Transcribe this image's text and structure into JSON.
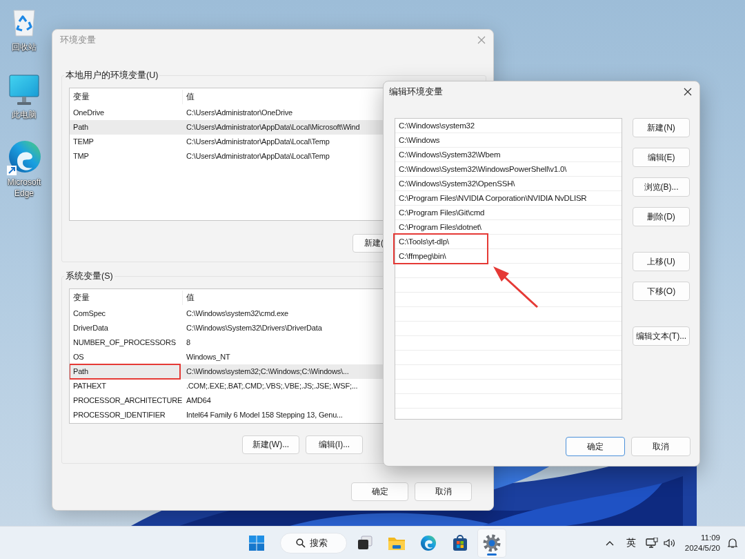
{
  "desktop_icons": [
    {
      "label": "回收站",
      "kind": "recycle-bin"
    },
    {
      "label": "此电脑",
      "kind": "computer"
    },
    {
      "label": "Microsoft Edge",
      "kind": "edge"
    }
  ],
  "env_dialog": {
    "title": "环境变量",
    "active": false,
    "user_group": {
      "label": "本地用户的环境变量(U)",
      "columns": [
        "变量",
        "值"
      ],
      "rows": [
        {
          "name": "OneDrive",
          "value": "C:\\Users\\Administrator\\OneDrive",
          "selected": false,
          "highlighted": false
        },
        {
          "name": "Path",
          "value": "C:\\Users\\Administrator\\AppData\\Local\\Microsoft\\Wind",
          "selected": true,
          "highlighted": false
        },
        {
          "name": "TEMP",
          "value": "C:\\Users\\Administrator\\AppData\\Local\\Temp",
          "selected": false,
          "highlighted": false
        },
        {
          "name": "TMP",
          "value": "C:\\Users\\Administrator\\AppData\\Local\\Temp",
          "selected": false,
          "highlighted": false
        }
      ],
      "buttons": [
        "新建("
      ]
    },
    "system_group": {
      "label": "系统变量(S)",
      "columns": [
        "变量",
        "值"
      ],
      "rows": [
        {
          "name": "ComSpec",
          "value": "C:\\Windows\\system32\\cmd.exe",
          "selected": false,
          "highlighted": false
        },
        {
          "name": "DriverData",
          "value": "C:\\Windows\\System32\\Drivers\\DriverData",
          "selected": false,
          "highlighted": false
        },
        {
          "name": "NUMBER_OF_PROCESSORS",
          "value": "8",
          "selected": false,
          "highlighted": false
        },
        {
          "name": "OS",
          "value": "Windows_NT",
          "selected": false,
          "highlighted": false
        },
        {
          "name": "Path",
          "value": "C:\\Windows\\system32;C:\\Windows;C:\\Windows\\...",
          "selected": true,
          "highlighted": true
        },
        {
          "name": "PATHEXT",
          "value": ".COM;.EXE;.BAT;.CMD;.VBS;.VBE;.JS;.JSE;.WSF;...",
          "selected": false,
          "highlighted": false
        },
        {
          "name": "PROCESSOR_ARCHITECTURE",
          "value": "AMD64",
          "selected": false,
          "highlighted": false
        },
        {
          "name": "PROCESSOR_IDENTIFIER",
          "value": "Intel64 Family 6 Model 158 Stepping 13, Genu...",
          "selected": false,
          "highlighted": false
        }
      ],
      "buttons": [
        "新建(W)...",
        "编辑(I)..."
      ]
    },
    "buttons": [
      "确定",
      "取消"
    ]
  },
  "edit_dialog": {
    "title": "编辑环境变量",
    "active": true,
    "callout_arrow": true,
    "entries": [
      {
        "text": "C:\\Windows\\system32",
        "selected": false,
        "highlighted": false
      },
      {
        "text": "C:\\Windows",
        "selected": false,
        "highlighted": false
      },
      {
        "text": "C:\\Windows\\System32\\Wbem",
        "selected": false,
        "highlighted": false
      },
      {
        "text": "C:\\Windows\\System32\\WindowsPowerShell\\v1.0\\",
        "selected": false,
        "highlighted": false
      },
      {
        "text": "C:\\Windows\\System32\\OpenSSH\\",
        "selected": false,
        "highlighted": false
      },
      {
        "text": "C:\\Program Files\\NVIDIA Corporation\\NVIDIA NvDLISR",
        "selected": false,
        "highlighted": false
      },
      {
        "text": "C:\\Program Files\\Git\\cmd",
        "selected": false,
        "highlighted": false
      },
      {
        "text": "C:\\Program Files\\dotnet\\",
        "selected": false,
        "highlighted": false
      },
      {
        "text": "C:\\Tools\\yt-dlp\\",
        "selected": false,
        "highlighted": true
      },
      {
        "text": "C:\\ffmpeg\\bin\\",
        "selected": false,
        "highlighted": true
      }
    ],
    "side_buttons": [
      [
        "新建(N)",
        "编辑(E)",
        "浏览(B)...",
        "删除(D)"
      ],
      [
        "上移(U)",
        "下移(O)"
      ],
      [
        "编辑文本(T)..."
      ]
    ],
    "buttons": [
      {
        "label": "确定",
        "default": true
      },
      {
        "label": "取消",
        "default": false
      }
    ]
  },
  "taskbar": {
    "search_label": "搜索",
    "apps": [
      {
        "kind": "task-view",
        "active": false
      },
      {
        "kind": "files",
        "active": false
      },
      {
        "kind": "edge",
        "active": false
      },
      {
        "kind": "store",
        "active": false
      },
      {
        "kind": "settings",
        "active": true
      }
    ],
    "input_language": "英",
    "time": "11:09",
    "date": "2024/5/20"
  }
}
